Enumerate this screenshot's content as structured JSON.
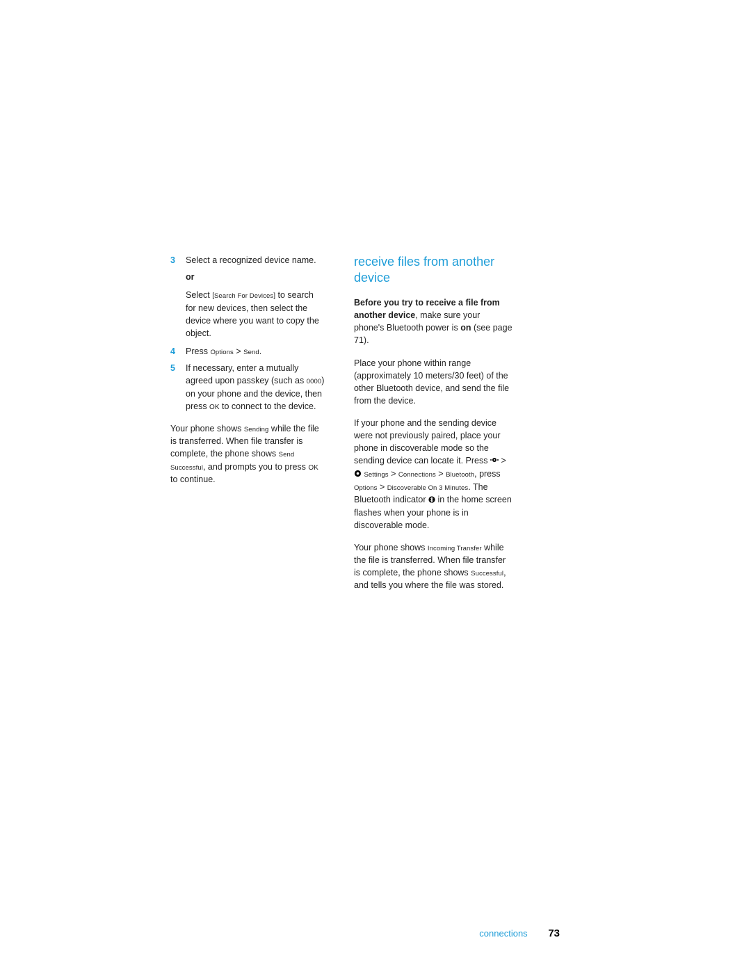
{
  "left": {
    "step3": {
      "num": "3",
      "line1": "Select a recognized device name.",
      "or": "or",
      "p2a": "Select ",
      "p2_ui_open": "[",
      "p2_ui": "Search For Devices",
      "p2_ui_close": "]",
      "p2b": " to search for new devices, then select the device where you want to copy the object."
    },
    "step4": {
      "num": "4",
      "a": "Press ",
      "ui1": "Options",
      "sep": " > ",
      "ui2": "Send",
      "end": "."
    },
    "step5": {
      "num": "5",
      "a": "If necessary, enter a mutually agreed upon passkey (such as ",
      "code": "0000",
      "b": ") on your phone and the device, then press ",
      "ok": "OK",
      "c": " to connect to the device."
    },
    "after": {
      "a": "Your phone shows ",
      "ui1": "Sending",
      "b": " while the file is transferred. When file transfer is complete, the phone shows ",
      "ui2": "Send Successful",
      "c": ", and prompts you to press ",
      "ok": "OK",
      "d": " to continue."
    }
  },
  "right": {
    "heading": "receive files from another device",
    "p1": {
      "bold": "Before you try to receive a file from another device",
      "a": ", make sure your phone's Bluetooth power is ",
      "on": "on",
      "b": " (see page 71)."
    },
    "p2": "Place your phone within range (approximately 10 meters/30 feet) of the other Bluetooth device, and send the file from the device.",
    "p3": {
      "a": "If your phone and the sending device were not previously paired, place your phone in discoverable mode so the sending device can locate it. Press ",
      "sep": " > ",
      "ui_settings": "Settings",
      "ui_conn": "Connections",
      "ui_bt": "Bluetooth",
      "press": ", press ",
      "ui_opt": "Options",
      "ui_disc": "Discoverable On 3 Minutes",
      "b": ". The Bluetooth indicator ",
      "c": " in the home screen flashes when your phone is in discoverable mode."
    },
    "p4": {
      "a": "Your phone shows ",
      "ui1": "Incoming Transfer",
      "b": " while the file is transferred. When file transfer is complete, the phone shows ",
      "ui2": "Successful",
      "c": ", and tells you where the file was stored."
    }
  },
  "footer": {
    "section": "connections",
    "page": "73"
  }
}
